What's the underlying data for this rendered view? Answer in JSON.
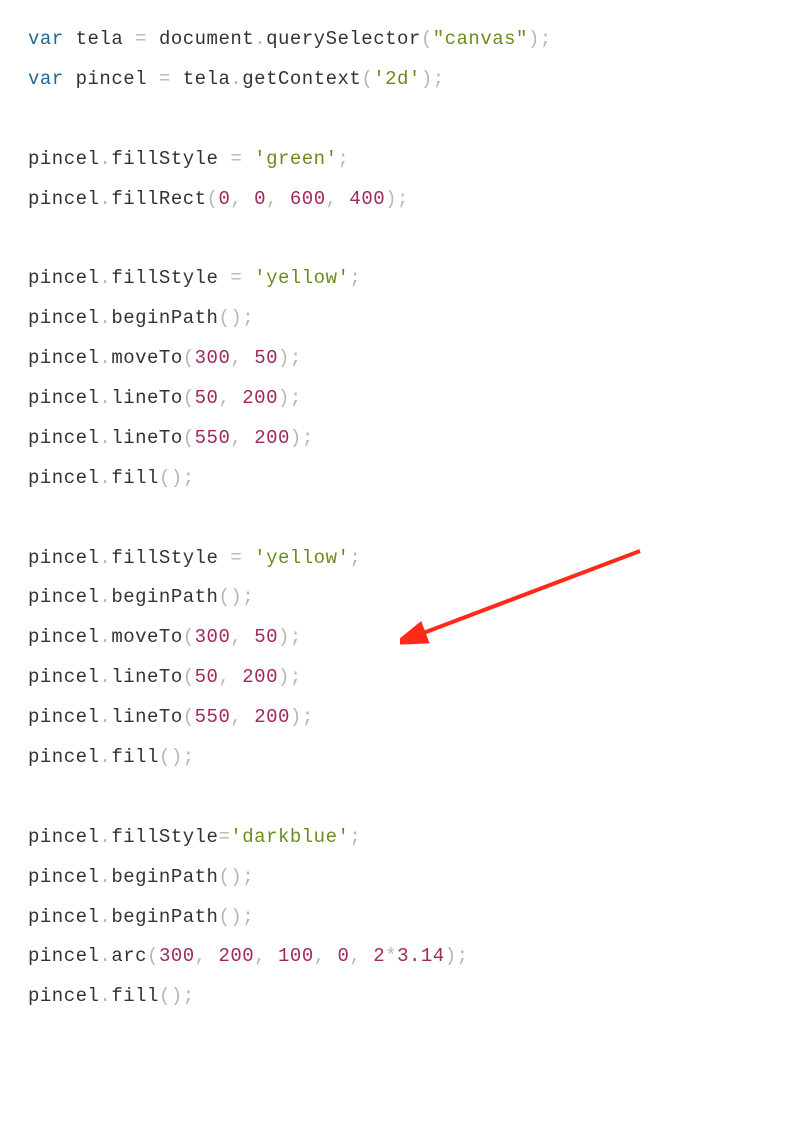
{
  "code": {
    "kw_var": "var",
    "tela": "tela",
    "pincel": "pincel",
    "document": "document",
    "querySelector": "querySelector",
    "getContext": "getContext",
    "fillStyle": "fillStyle",
    "fillRect": "fillRect",
    "beginPath": "beginPath",
    "moveTo": "moveTo",
    "lineTo": "lineTo",
    "fill": "fill",
    "arc": "arc",
    "eq": " = ",
    "eq2": "=",
    "dot": ".",
    "com": ",",
    "sp": " ",
    "lp": "(",
    "rp": ")",
    "sc": ";",
    "star": "*",
    "str_canvas": "\"canvas\"",
    "str_2d": "'2d'",
    "str_green": "'green'",
    "str_yellow": "'yellow'",
    "str_darkblue": "'darkblue'",
    "n0": "0",
    "n600": "600",
    "n400": "400",
    "n300": "300",
    "n50": "50",
    "n200": "200",
    "n550": "550",
    "n100": "100",
    "n2": "2",
    "n314": "3.14"
  },
  "annotation": {
    "arrow_color": "#ff2a1a"
  }
}
